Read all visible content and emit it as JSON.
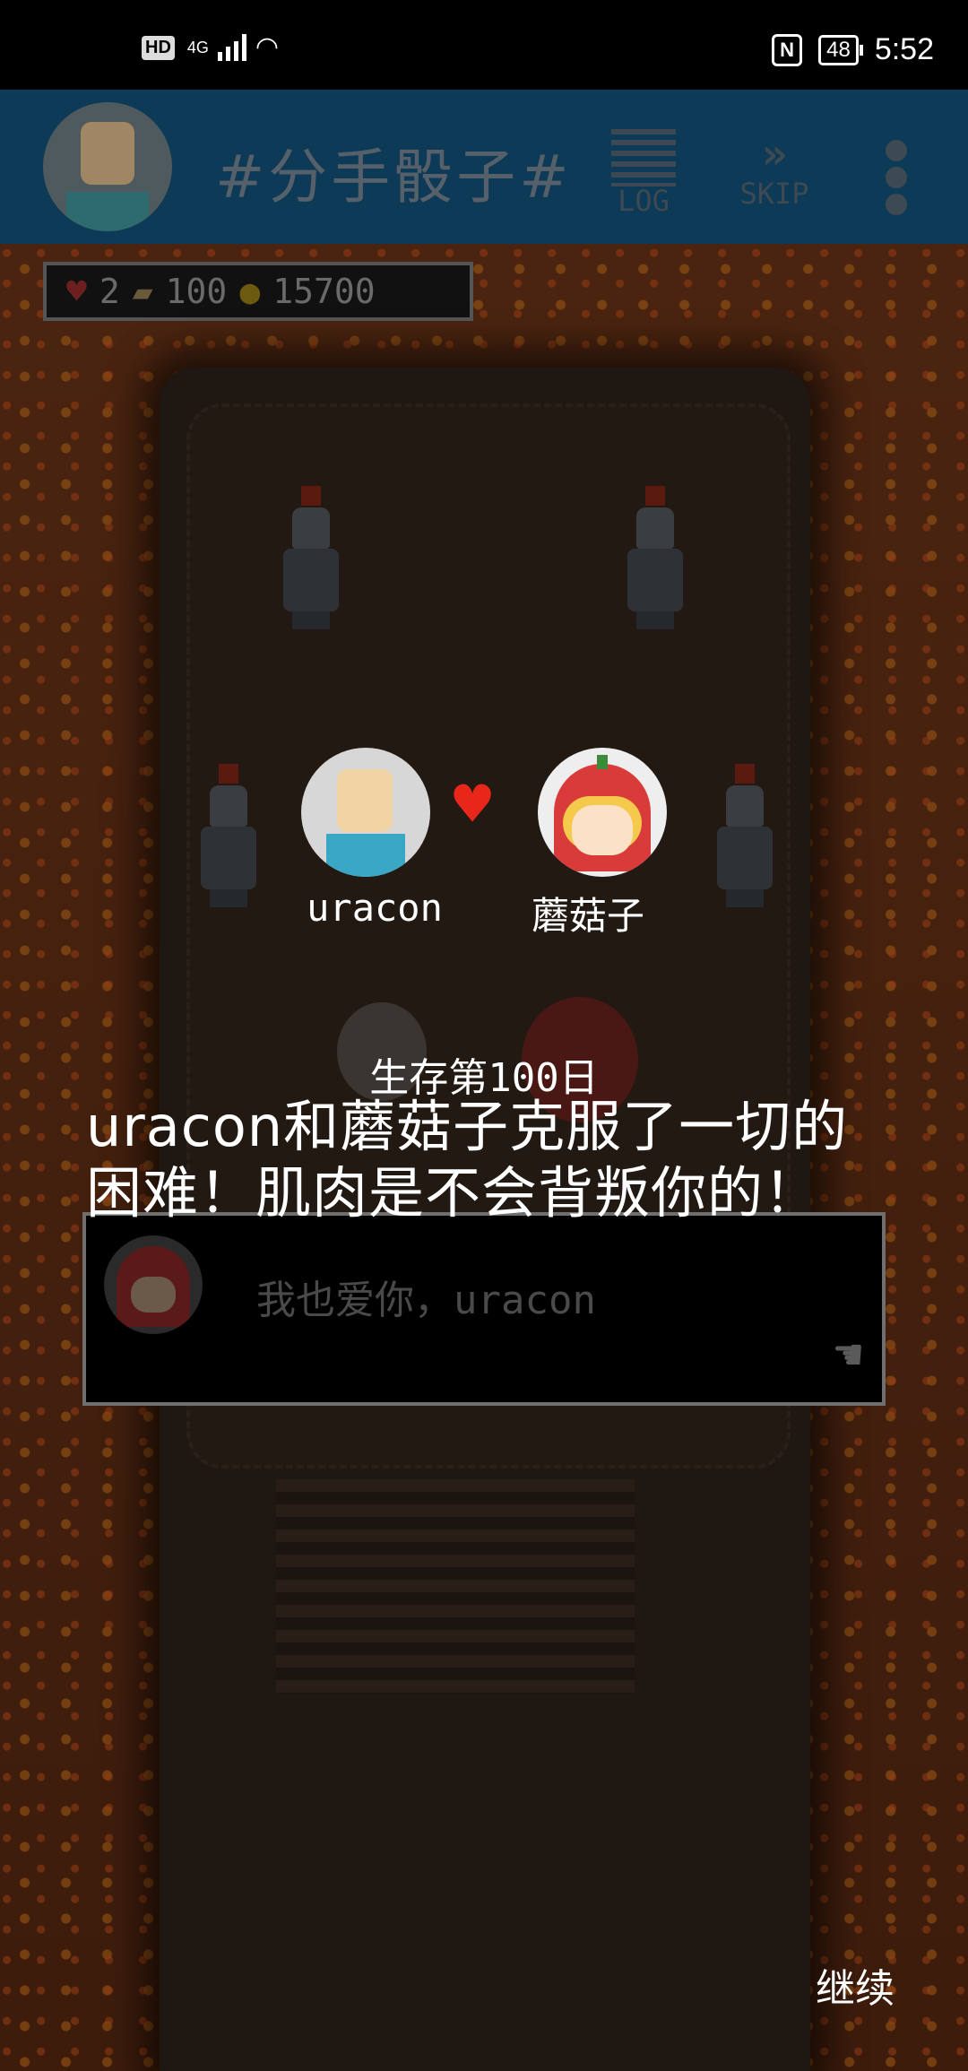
{
  "status_bar": {
    "hd": "HD",
    "network": "4G",
    "battery": "48",
    "time": "5:52"
  },
  "header": {
    "title": "#分手骰子#",
    "log_label": "LOG",
    "skip_label": "SKIP"
  },
  "stats": {
    "lives": "2",
    "cards": "100",
    "coins": "15700"
  },
  "pairing": {
    "left_name": "uracon",
    "right_name": "蘑菇子"
  },
  "result": {
    "day": "生存第100日",
    "message": "uracon和蘑菇子克服了一切的困难！肌肉是不会背叛你的！"
  },
  "dialog": {
    "text": "我也爱你，uracon"
  },
  "continue_label": "继续"
}
